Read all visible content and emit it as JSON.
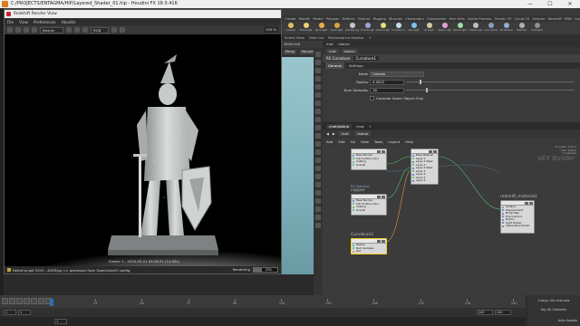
{
  "window": {
    "title": "C:/PROJECTS/ENTAGMA/HIP/Layered_Shader_01.hip - Houdini FX 18.0.416"
  },
  "menu": [
    "File",
    "Edit",
    "Render",
    "Assets",
    "Windows",
    "Redshift",
    "Help"
  ],
  "build_label": "Build",
  "main_label": "Main",
  "shelf_tabs": [
    "Create",
    "Modify",
    "Model",
    "Polygon",
    "Deform",
    "Texture",
    "Rigging",
    "Muscles",
    "Characters",
    "Constraints",
    "Hair Utils",
    "Guide Process",
    "Terrain FX",
    "Cloud FX",
    "Volume",
    "Redshift",
    "RBD",
    "Lights a",
    "Collisions",
    "Particles",
    "Grains",
    "Vellum",
    "Rigid Bodies",
    "Particle Fl",
    "Viscous Fl",
    "Oceans",
    "Fluid Co",
    "Populate C",
    "Container",
    "Pyro FX",
    "FEM",
    "Wires",
    "Crowds",
    "Drive Simu"
  ],
  "shelf_tools": [
    "Camera",
    "Point Light",
    "Spot Light",
    "Area Light",
    "Geometry Light",
    "Volume Light",
    "Distant Light",
    "Environment Light",
    "Sky Light",
    "GI Light",
    "Caustic Light",
    "Portal Light",
    "Ambient Light",
    "Stereo Camera",
    "VR Camera",
    "Switcher",
    "Gamepad"
  ],
  "desktop_tabs": [
    "Scene View",
    "Take List",
    "Performance Monitor",
    "+"
  ],
  "render_view": {
    "title": "Redshift Render View",
    "menu": [
      "File",
      "View",
      "Preferences",
      "Houdini"
    ],
    "aov": "Beauty",
    "mode": "RGB",
    "zoom": "100 %",
    "frame_label": "Frame: 1 - 2020-05-21 09:36:31 (14.05s)",
    "status": "Failed to get OCIO - ACES/sg => processor from OpenColorIO config",
    "rendering_label": "Rendering",
    "progress": 0.33,
    "progress_text": "33%"
  },
  "scene_view": {
    "path_label": "3840x1x6",
    "persp": "Persp",
    "cam": "No cam"
  },
  "param_pane": {
    "tabs": [
      "mat",
      "statue"
    ],
    "node_type": "RS Curvature",
    "node_name": "Curvature1",
    "subtabs": [
      "General",
      "Settings"
    ],
    "rows": [
      {
        "label": "Mode",
        "kind": "dropdown",
        "value": "Convex"
      },
      {
        "label": "Radius",
        "kind": "slider",
        "value": "0.0922",
        "fraction": 0.08
      },
      {
        "label": "Num Samples",
        "kind": "slider",
        "value": "16",
        "fraction": 0.12
      },
      {
        "label": "",
        "kind": "checkbox",
        "value": "Consider Same Object Only"
      }
    ]
  },
  "network": {
    "tabs": [
      "/mat/statue",
      "/mat",
      "+"
    ],
    "path": [
      "mat",
      "statue"
    ],
    "menu": [
      "Add",
      "Edit",
      "Go",
      "View",
      "Tools",
      "Layout",
      "Help"
    ],
    "watermark": "VEX Builder",
    "info": [
      "6 nodes, 0.01 s",
      "mat: statue",
      "0 selected"
    ],
    "nodes": {
      "bump": {
        "label": "",
        "rows": [
          "Base Normal",
          "Sub Surface Color",
          "Coating",
          "Overall"
        ]
      },
      "copper": {
        "label": "copper",
        "title_sub": "RS Material",
        "rows": [
          "Base Normal",
          "Sub Surface Color",
          "Coating",
          "Overall"
        ]
      },
      "curvature": {
        "label": "Curvature1",
        "rows": [
          "Radius",
          "Num Samples",
          "Out"
        ]
      },
      "layer": {
        "label": "",
        "rows": [
          "Base Material",
          "Layer 1",
          "Layer 1 Mask",
          "Layer 2",
          "Layer 2 Mask",
          "Layer 3",
          "Layer 4",
          "Layer 5",
          "Layer 6"
        ]
      },
      "output": {
        "label": "redshift_material1",
        "rows": [
          "Surface",
          "Displacement",
          "Bump Map",
          "Environment",
          "Photon",
          "Light Shader",
          "Subsurface Shader"
        ]
      }
    }
  },
  "timeline": {
    "ticks": [
      1,
      24,
      48,
      72,
      96,
      120,
      144,
      168,
      192,
      216,
      240
    ],
    "frame": "1",
    "start": "1",
    "start2": "1",
    "end": "240",
    "end2": "240",
    "keys_info": "0 keys, 0/0 channels",
    "key_all": "Key All Channels",
    "auto_update": "Auto Update"
  }
}
